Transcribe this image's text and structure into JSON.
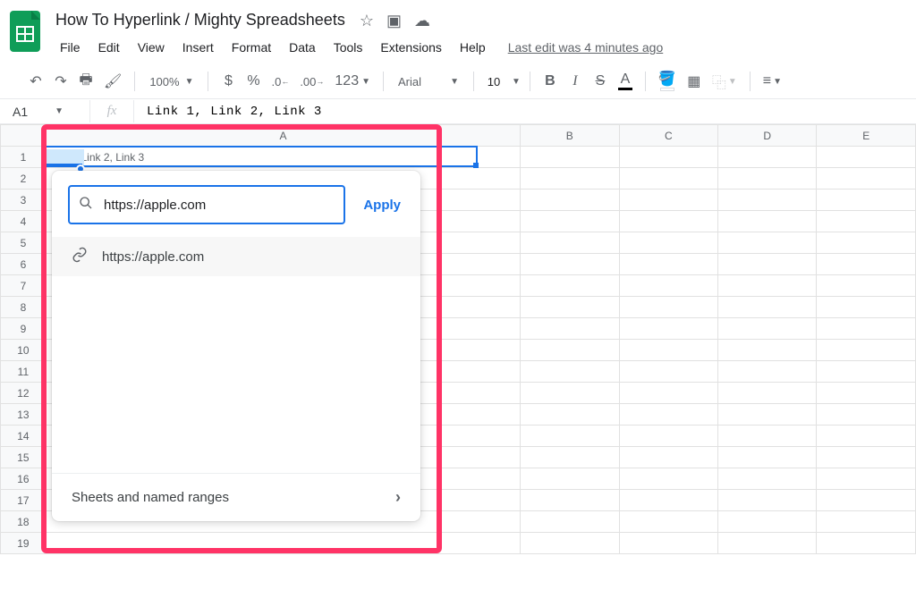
{
  "doc": {
    "title": "How To Hyperlink / Mighty Spreadsheets",
    "last_edit": "Last edit was 4 minutes ago"
  },
  "menu": {
    "file": "File",
    "edit": "Edit",
    "view": "View",
    "insert": "Insert",
    "format": "Format",
    "data": "Data",
    "tools": "Tools",
    "extensions": "Extensions",
    "help": "Help"
  },
  "toolbar": {
    "zoom": "100%",
    "currency": "$",
    "percent": "%",
    "dec_dec": ".0",
    "inc_dec": ".00",
    "num_format": "123",
    "font": "Arial",
    "font_size": "10",
    "bold": "B",
    "italic": "I",
    "strike": "S",
    "text_color_letter": "A"
  },
  "formula_bar": {
    "cell_ref": "A1",
    "fx": "fx",
    "content": "Link 1, Link 2, Link 3"
  },
  "columns": [
    "A",
    "B",
    "C",
    "D",
    "E"
  ],
  "rows": [
    "1",
    "2",
    "3",
    "4",
    "5",
    "6",
    "7",
    "8",
    "9",
    "10",
    "11",
    "12",
    "13",
    "14",
    "15",
    "16",
    "17",
    "18",
    "19"
  ],
  "cell_a1": "Link 1, Link 2, Link 3",
  "link_popup": {
    "search_value": "https://apple.com",
    "apply": "Apply",
    "suggestion": "https://apple.com",
    "footer": "Sheets and named ranges"
  }
}
